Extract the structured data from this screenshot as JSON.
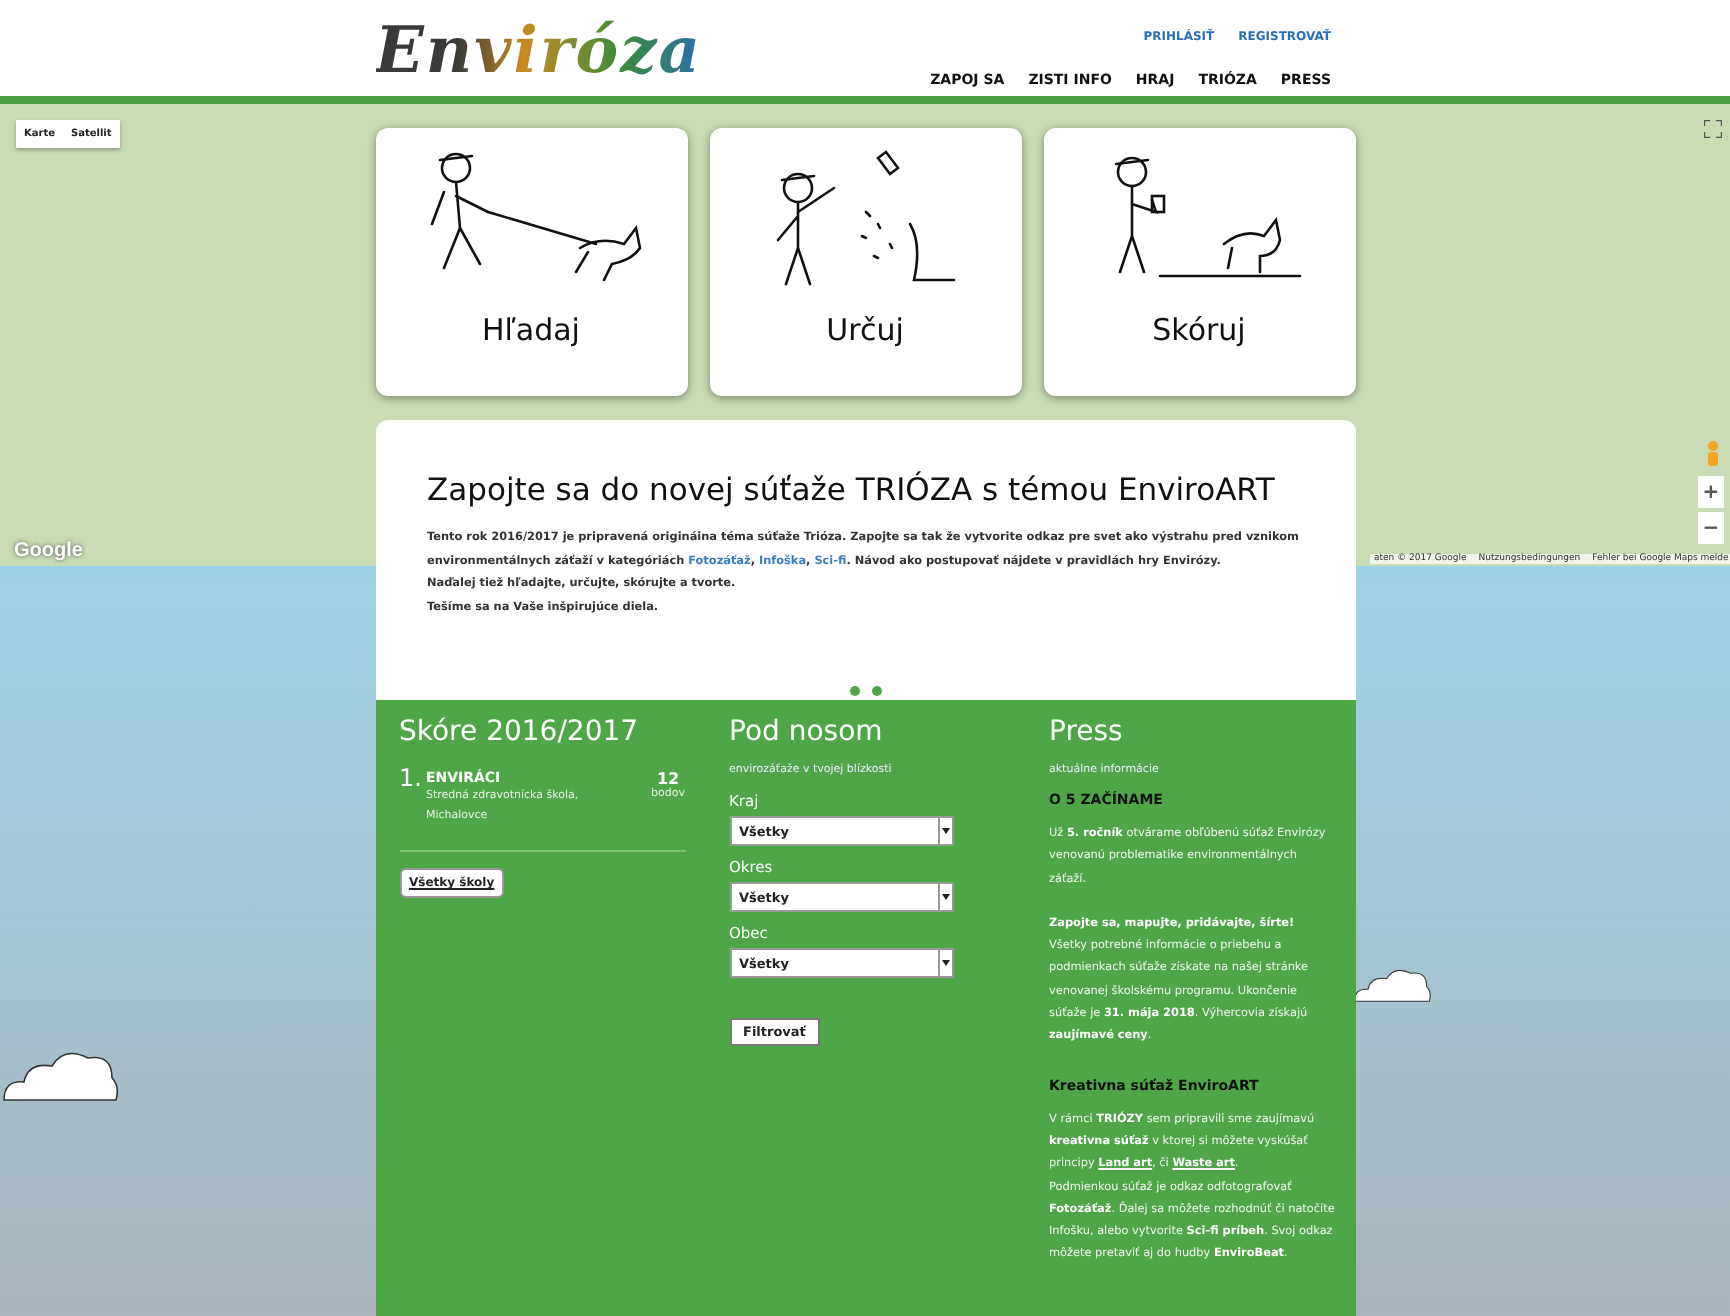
{
  "header": {
    "logo": "Enviróza",
    "account_links": [
      "PRIHLÁSIŤ",
      "REGISTROVAŤ"
    ],
    "nav": [
      "ZAPOJ SA",
      "ZISTI INFO",
      "HRAJ",
      "TRIÓZA",
      "PRESS"
    ]
  },
  "map": {
    "type_buttons": [
      "Karte",
      "Satellit"
    ],
    "zoom_in": "+",
    "zoom_out": "−",
    "logo": "Google",
    "attribution": [
      "aten © 2017 Google",
      "Nutzungsbedingungen",
      "Fehler bei Google Maps melde"
    ]
  },
  "cards": [
    {
      "label": "Hľadaj",
      "kind": "walk"
    },
    {
      "label": "Určuj",
      "kind": "point"
    },
    {
      "label": "Skóruj",
      "kind": "note"
    }
  ],
  "intro": {
    "title": "Zapojte sa do novej súťaže TRIÓZA s témou EnviroART",
    "paragraphs": [
      [
        {
          "kind": "text",
          "text": "Tento rok 2016/2017 je pripravená origináina téma súťaže Trióza. Zapojte sa tak že vytvorite odkaz pre svet ako výstrahu pred vznikom environmentálnych záťaží v kategóriách "
        },
        {
          "kind": "link",
          "text": "Fotozáťaž"
        },
        {
          "kind": "text",
          "text": ", "
        },
        {
          "kind": "link",
          "text": "Infoška"
        },
        {
          "kind": "text",
          "text": ", "
        },
        {
          "kind": "link",
          "text": "Sci-fi"
        },
        {
          "kind": "text",
          "text": ". Návod ako postupovať nájdete v pravidlách hry Envirózy."
        }
      ],
      [
        {
          "kind": "text",
          "text": "Naďalej tiež hľadajte, určujte, skórujte a tvorte."
        }
      ],
      [
        {
          "kind": "text",
          "text": "Tešíme sa na Vaše inšpirujúce diela."
        }
      ]
    ]
  },
  "score": {
    "title": "Skóre 2016/2017",
    "entries": [
      {
        "rank": "1.",
        "team": "ENVIRÁCI",
        "school": "Stredná zdravotnícka škola, Michalovce",
        "points": "12",
        "unit": "bodov"
      }
    ],
    "button": "Všetky školy"
  },
  "nearby": {
    "title": "Pod nosom",
    "subtitle": "envirozáťaže v tvojej blízkosti",
    "filters": [
      {
        "label": "Kraj",
        "value": "Všetky"
      },
      {
        "label": "Okres",
        "value": "Všetky"
      },
      {
        "label": "Obec",
        "value": "Všetky"
      }
    ],
    "button": "Filtrovať"
  },
  "press": {
    "title": "Press",
    "subtitle": "aktuálne informácie",
    "blocks": [
      {
        "kind": "heading",
        "parts": [
          {
            "kind": "text",
            "text": "O 5 ZAČÍNAME"
          }
        ]
      },
      {
        "kind": "paragraph",
        "parts": [
          {
            "kind": "text",
            "text": "Už **5. ročník** otvárame obľúbenú súťaž Envirózy venovanú problematike environmentálnych záťaží."
          }
        ]
      },
      {
        "kind": "paragraph",
        "parts": [
          {
            "kind": "text",
            "text": "**Zapojte sa, mapujte, pridávajte, šírte!**"
          }
        ]
      },
      {
        "kind": "paragraph",
        "parts": [
          {
            "kind": "text",
            "text": "Všetky potrebné informácie o priebehu a podmienkach súťaže získate na našej stránke venovanej školskému programu. Ukončenie súťaže je **31. mája 2018**. Výhercovia získajú **zaujímavé ceny**."
          }
        ]
      },
      {
        "kind": "heading",
        "parts": [
          {
            "kind": "text",
            "text": "Kreativna súťaž EnviroART"
          }
        ]
      },
      {
        "kind": "paragraph",
        "parts": [
          {
            "kind": "text",
            "text": "V rámci **TRIÓZY** sem pripravili sme zaujímavú **kreativna súťaž** v ktorej si môžete vyskúšať principy "
          },
          {
            "kind": "link",
            "text": "Land art"
          },
          {
            "kind": "text",
            "text": ", či "
          },
          {
            "kind": "link",
            "text": "Waste art"
          },
          {
            "kind": "text",
            "text": "."
          }
        ]
      },
      {
        "kind": "paragraph",
        "parts": [
          {
            "kind": "text",
            "text": "Podmienkou súťaž je odkaz odfotografovať **Fotozáťaž**. Ďalej sa môžete rozhodnúť či natočíte Infošku, alebo vytvorite **Sci-fi príbeh**. Svoj odkaz môžete pretaviť aj do hudby **EnviroBeat**."
          }
        ]
      }
    ]
  }
}
